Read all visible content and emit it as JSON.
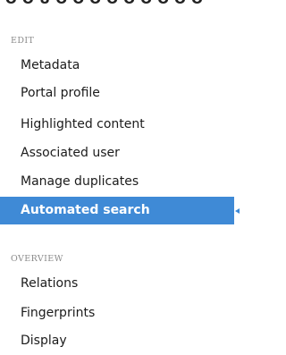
{
  "header": {
    "cut_text": "O O U O O O O O O O O O"
  },
  "sections": {
    "edit": {
      "title": "EDIT",
      "items": [
        {
          "label": "Metadata"
        },
        {
          "label": "Portal profile"
        },
        {
          "label": "Highlighted content"
        },
        {
          "label": "Associated user"
        },
        {
          "label": "Manage duplicates"
        },
        {
          "label": "Automated search",
          "active": true
        }
      ]
    },
    "overview": {
      "title": "OVERVIEW",
      "items": [
        {
          "label": "Relations"
        },
        {
          "label": "Fingerprints"
        },
        {
          "label": "Display"
        }
      ]
    }
  },
  "colors": {
    "active_bg": "#3f8ad6",
    "section_title": "#8a8a8a",
    "text": "#1b1b1b"
  }
}
